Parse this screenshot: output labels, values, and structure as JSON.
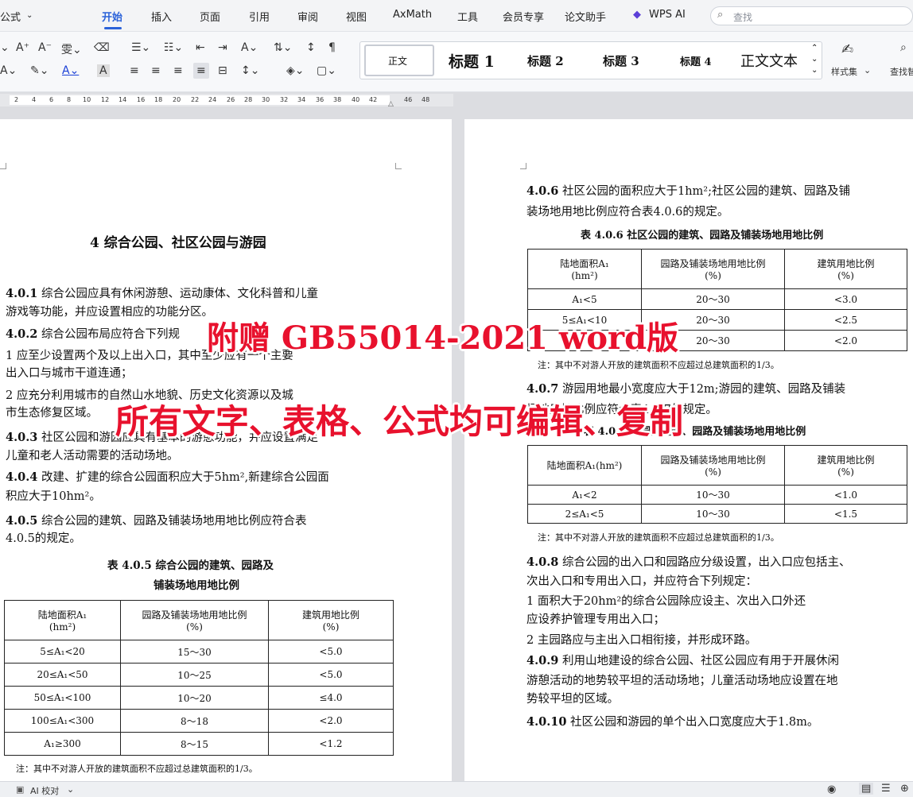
{
  "menu": {
    "left_partial": "公式",
    "items": [
      "开始",
      "插入",
      "页面",
      "引用",
      "审阅",
      "视图",
      "AxMath",
      "工具",
      "会员专享",
      "论文助手",
      "WPS AI"
    ],
    "search_placeholder": "查找"
  },
  "toolbar": {
    "styles": [
      "正文",
      "标题 1",
      "标题 2",
      "标题 3",
      "标题 4",
      "正文文本"
    ],
    "style_set_label": "样式集",
    "find_label": "查找替"
  },
  "ruler": {
    "ticks": [
      "2",
      "4",
      "6",
      "8",
      "10",
      "12",
      "14",
      "16",
      "18",
      "20",
      "22",
      "24",
      "26",
      "28",
      "30",
      "32",
      "34",
      "36",
      "38",
      "40",
      "42",
      "46",
      "48"
    ]
  },
  "left": {
    "heading": "4  综合公园、社区公园与游园",
    "lines": [
      {
        "b": "4.0.1",
        "t": "  综合公园应具有休闲游憩、运动康体、文化科普和儿童"
      },
      {
        "b": "",
        "t": "游戏等功能，并应设置相应的功能分区。"
      },
      {
        "b": "4.0.2",
        "t": "  综合公园布局应符合下列规"
      },
      {
        "b": "",
        "t": "      1 应至少设置两个及以上出入口，其中至少应有一个主要"
      },
      {
        "b": "",
        "t": "出入口与城市干道连通；"
      },
      {
        "b": "",
        "t": "      2 应充分利用城市的自然山水地貌、历史文化资源以及城"
      },
      {
        "b": "",
        "t": "市生态修复区域。"
      },
      {
        "b": "4.0.3",
        "t": "  社区公园和游园应具有基本的游憩功能，并应设置满足"
      },
      {
        "b": "",
        "t": "儿童和老人活动需要的活动场地。"
      },
      {
        "b": "4.0.4",
        "t": "  改建、扩建的综合公园面积应大于5hm²,新建综合公园面"
      },
      {
        "b": "",
        "t": "积应大于10hm²。"
      },
      {
        "b": "4.0.5",
        "t": "  综合公园的建筑、园路及铺装场地用地比例应符合表"
      },
      {
        "b": "",
        "t": "4.0.5的规定。"
      }
    ],
    "table_title_1": "表 4.0.5  综合公园的建筑、园路及",
    "table_title_2": "铺装场地用地比例",
    "table_head": [
      "陆地面积A₁\n(hm²)",
      "园路及铺装场地用地比例\n(%)",
      "建筑用地比例\n(%)"
    ],
    "table_rows": [
      [
        "5≤A₁<20",
        "15～30",
        "<5.0"
      ],
      [
        "20≤A₁<50",
        "10～25",
        "<5.0"
      ],
      [
        "50≤A₁<100",
        "10～20",
        "≤4.0"
      ],
      [
        "100≤A₁<300",
        "8～18",
        "<2.0"
      ],
      [
        "A₁≥300",
        "8～15",
        "<1.2"
      ]
    ],
    "note": "注：其中不对游人开放的建筑面积不应超过总建筑面积的1/3。"
  },
  "right": {
    "l1": [
      {
        "b": "4.0.6",
        "t": "  社区公园的面积应大于1hm²;社区公园的建筑、园路及铺"
      },
      {
        "b": "",
        "t": "装场地用地比例应符合表4.0.6的规定。"
      }
    ],
    "t1_title": "表 4.0.6  社区公园的建筑、园路及铺装场地用地比例",
    "t1_head": [
      "陆地面积A₁\n(hm²)",
      "园路及铺装场地用地比例\n(%)",
      "建筑用地比例\n(%)"
    ],
    "t1_rows": [
      [
        "A₁<5",
        "20～30",
        "<3.0"
      ],
      [
        "5≤A₁<10",
        "20～30",
        "<2.5"
      ],
      [
        "",
        "20～30",
        "<2.0"
      ]
    ],
    "note": "注：其中不对游人开放的建筑面积不应超过总建筑面积的1/3。",
    "l2": [
      {
        "b": "4.0.7",
        "t": "  游园用地最小宽度应大于12m;游园的建筑、园路及铺装"
      },
      {
        "b": "",
        "t": "场地用地比例应符合表4.0.7的规定。"
      }
    ],
    "t2_title": "表 4.0.7  游园的建筑、园路及铺装场地用地比例",
    "t2_head": [
      "陆地面积A₁(hm²)",
      "园路及铺装场地用地比例\n(%)",
      "建筑用地比例\n(%)"
    ],
    "t2_rows": [
      [
        "A₁<2",
        "10～30",
        "<1.0"
      ],
      [
        "2≤A₁<5",
        "10～30",
        "<1.5"
      ]
    ],
    "l3": [
      {
        "b": "4.0.8",
        "t": "  综合公园的出入口和园路应分级设置，出入口应包括主、"
      },
      {
        "b": "",
        "t": "次出入口和专用出入口，并应符合下列规定："
      },
      {
        "b": "",
        "t": "      1 面积大于20hm²的综合公园除应设主、次出入口外还"
      },
      {
        "b": "",
        "t": "应设养护管理专用出入口；"
      },
      {
        "b": "",
        "t": "      2 主园路应与主出入口相衔接，并形成环路。"
      },
      {
        "b": "4.0.9",
        "t": "  利用山地建设的综合公园、社区公园应有用于开展休闲"
      },
      {
        "b": "",
        "t": "游憩活动的地势较平坦的活动场地；儿童活动场地应设置在地"
      },
      {
        "b": "",
        "t": "势较平坦的区域。"
      },
      {
        "b": "4.0.10",
        "t": "  社区公园和游园的单个出入口宽度应大于1.8m。"
      }
    ]
  },
  "overlay": {
    "line1": "附赠  GB55014-2021 word版",
    "line2": "所有文字、表格、公式均可编辑、复制"
  },
  "status": {
    "ai": "AI 校对"
  }
}
